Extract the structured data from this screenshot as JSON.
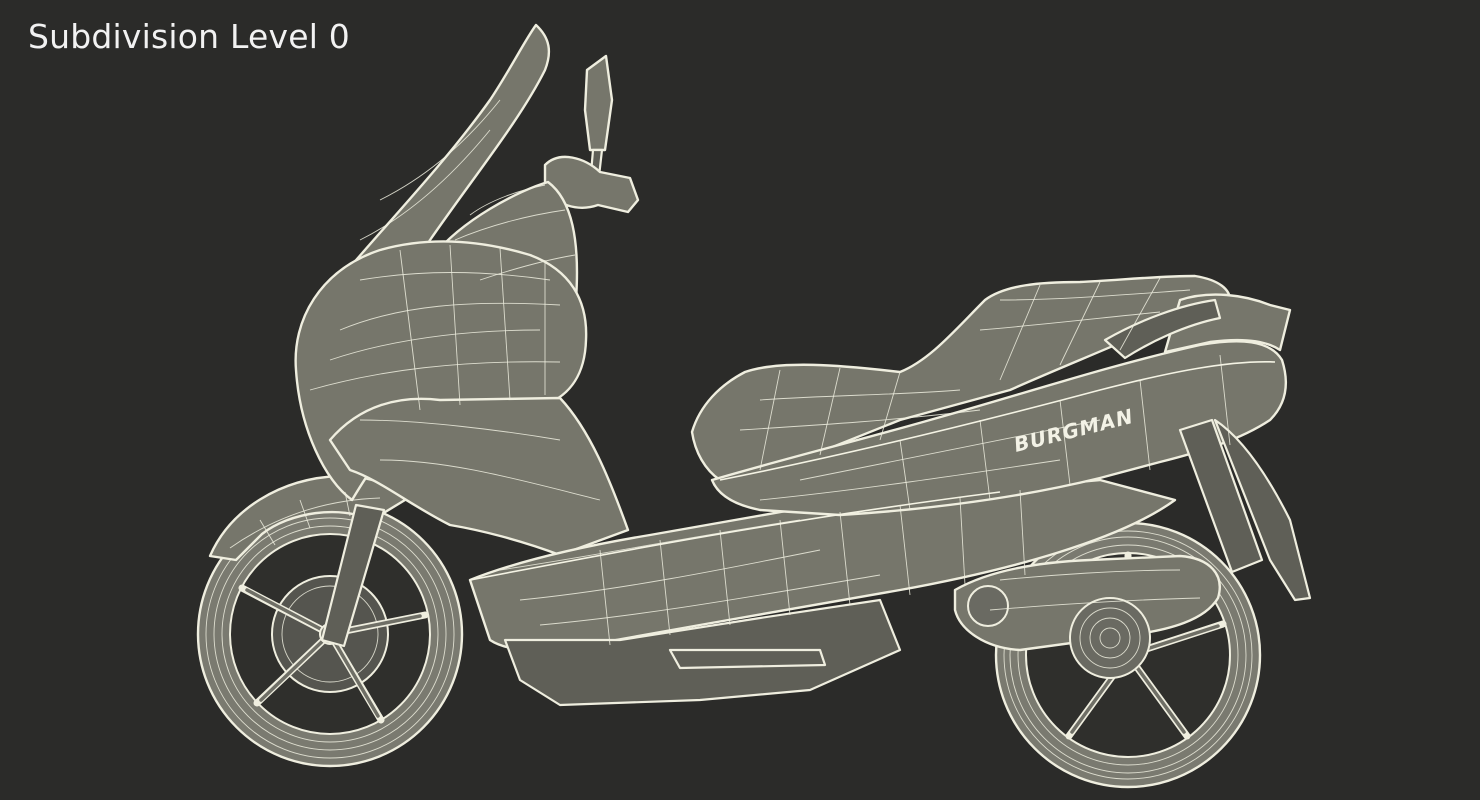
{
  "caption": "Subdivision Level 0",
  "model": {
    "logo_text": "BURGMAN"
  },
  "colors": {
    "background": "#2b2b29",
    "mesh_fill": "#76766b",
    "wireframe": "#efeedf",
    "caption_text": "#f2f2f2"
  }
}
